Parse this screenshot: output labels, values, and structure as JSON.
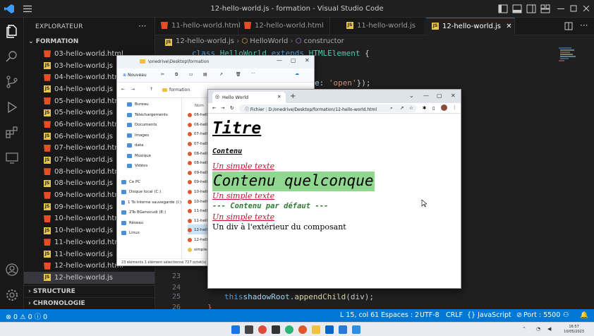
{
  "window": {
    "title": "12-hello-world.js - formation - Visual Studio Code"
  },
  "sidebar": {
    "header": "EXPLORATEUR",
    "more": "···",
    "section": "FORMATION",
    "files": [
      {
        "name": "03-hello-world.html",
        "type": "html"
      },
      {
        "name": "03-hello-world.js",
        "type": "js"
      },
      {
        "name": "04-hello-world.html",
        "type": "html"
      },
      {
        "name": "04-hello-world.js",
        "type": "js"
      },
      {
        "name": "05-hello-world.html",
        "type": "html"
      },
      {
        "name": "05-hello-world.js",
        "type": "js"
      },
      {
        "name": "06-hello-world.html",
        "type": "html"
      },
      {
        "name": "06-hello-world.js",
        "type": "js"
      },
      {
        "name": "07-hello-world.html",
        "type": "html"
      },
      {
        "name": "07-hello-world.js",
        "type": "js"
      },
      {
        "name": "08-hello-world.html",
        "type": "html"
      },
      {
        "name": "08-hello-world.js",
        "type": "js"
      },
      {
        "name": "09-hello-world.html",
        "type": "html"
      },
      {
        "name": "09-hello-world.js",
        "type": "js"
      },
      {
        "name": "10-hello-world.html",
        "type": "html"
      },
      {
        "name": "10-hello-world.js",
        "type": "js"
      },
      {
        "name": "11-hello-world.html",
        "type": "html"
      },
      {
        "name": "11-hello-world.js",
        "type": "js"
      },
      {
        "name": "12-hello-world.html",
        "type": "html"
      },
      {
        "name": "12-hello-world.js",
        "type": "js"
      }
    ],
    "structure": "STRUCTURE",
    "timeline": "CHRONOLOGIE"
  },
  "tabs": [
    {
      "label": "11-hello-world.html",
      "type": "html"
    },
    {
      "label": "12-hello-world.html",
      "type": "html"
    },
    {
      "label": "11-hello-world.js",
      "type": "js"
    },
    {
      "label": "12-hello-world.js",
      "type": "js",
      "close": "✕"
    }
  ],
  "breadcrumb": {
    "file": "12-hello-world.js",
    "cls": "HelloWorld",
    "member": "constructor"
  },
  "code": {
    "l1_kw": "class ",
    "l1_cls": "HelloWorld ",
    "l1_kw2": "extends ",
    "l1_cls2": "HTMLElement ",
    "l1_p": "{",
    "l2_a": "e: ",
    "l2_str": "'open'",
    "l2_b": "});",
    "l25_var": "this",
    ".": ".",
    "l25_b": "shadowRoot.",
    "l25_fn": "appendChild",
    "l25_c": "(div);",
    "l26": "}",
    "lines": [
      "23",
      "24",
      "25",
      "26"
    ]
  },
  "statusbar": {
    "problems": "⊗ 0 ⚠ 0  ⓘ 0",
    "position": "L 15, col 61",
    "spaces": "Espaces : 2",
    "encoding": "UTF-8",
    "eol": "CRLF",
    "language": "{} JavaScript",
    "port": "Port : 5500"
  },
  "taskbar": {
    "time": "16:57",
    "date": "10/05/2023"
  },
  "explorer": {
    "path_title": "\\onedrive\\Desktop\\formation",
    "new_button": "Nouveau",
    "folder": "formation",
    "column": "Nom",
    "nav": [
      "Bureau",
      "Téléchargements",
      "Documents",
      "Images",
      "data",
      "Musique",
      "Vidéos",
      "Ce PC",
      "Disque local (C:)",
      "1 To Interne sauvegarde (I:)",
      "2To BGenocudi (E:)",
      "Réseau",
      "Linux"
    ],
    "items": [
      "06-hello",
      "06-hello",
      "07-hello",
      "07-hello",
      "08-hello",
      "08-hello",
      "09-hello",
      "09-hello",
      "10-hello",
      "10-hello",
      "11-hello",
      "11-hello",
      "12-hello",
      "12-hello",
      "simple-"
    ],
    "status": "23 éléments    1 élément sélectionné  727 octet(s)"
  },
  "browser": {
    "tab_title": "Hello World",
    "new_tab": "+",
    "url_prefix": "Fichier",
    "url": "D:/onedrive/Desktop/formation/12-hello-world.html",
    "content": {
      "h1": "Titre",
      "h3": "Contenu",
      "red1": "Un simple texte",
      "big": "Contenu quelconque",
      "red2": "Un simple texte",
      "default": "--- Contenu par défaut ---",
      "red3": "Un simple texte",
      "outside": "Un div à l'extérieur du composant"
    }
  }
}
